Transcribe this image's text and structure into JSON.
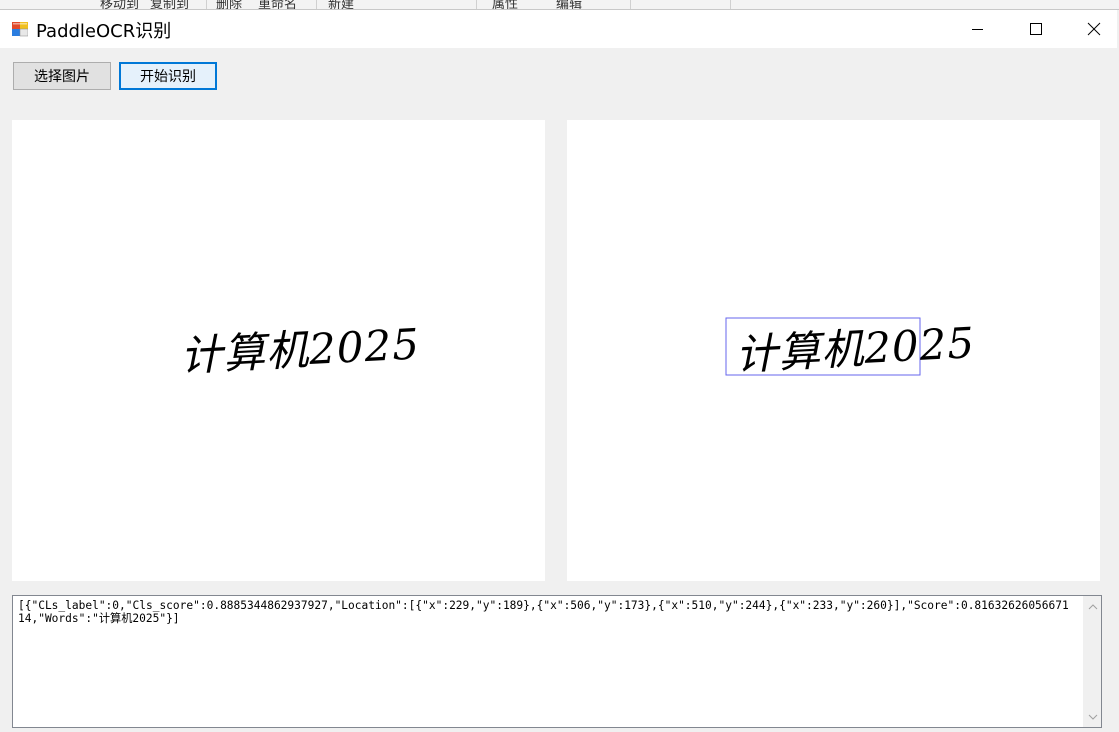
{
  "background_explorer": {
    "items": [
      "移动到",
      "复制到",
      "删除",
      "重命名",
      "新建",
      "属性",
      "编辑"
    ]
  },
  "window": {
    "title": "PaddleOCR识别",
    "icon": "winforms-app-icon",
    "controls": {
      "minimize": "minimize-icon",
      "maximize": "maximize-icon",
      "close": "close-icon"
    }
  },
  "toolbar": {
    "select_image_label": "选择图片",
    "start_recognize_label": "开始识别"
  },
  "images": {
    "source_text": "计算机2025",
    "result_text": "计算机2025",
    "box_color": "#6666ee"
  },
  "result": {
    "text": "[{\"CLs_label\":0,\"Cls_score\":0.8885344862937927,\"Location\":[{\"x\":229,\"y\":189},{\"x\":506,\"y\":173},{\"x\":510,\"y\":244},{\"x\":233,\"y\":260}],\"Score\":0.8163262605667114,\"Words\":\"计算机2025\"}]"
  },
  "colors": {
    "accent": "#0078d7",
    "window_bg": "#f0f0f0"
  }
}
